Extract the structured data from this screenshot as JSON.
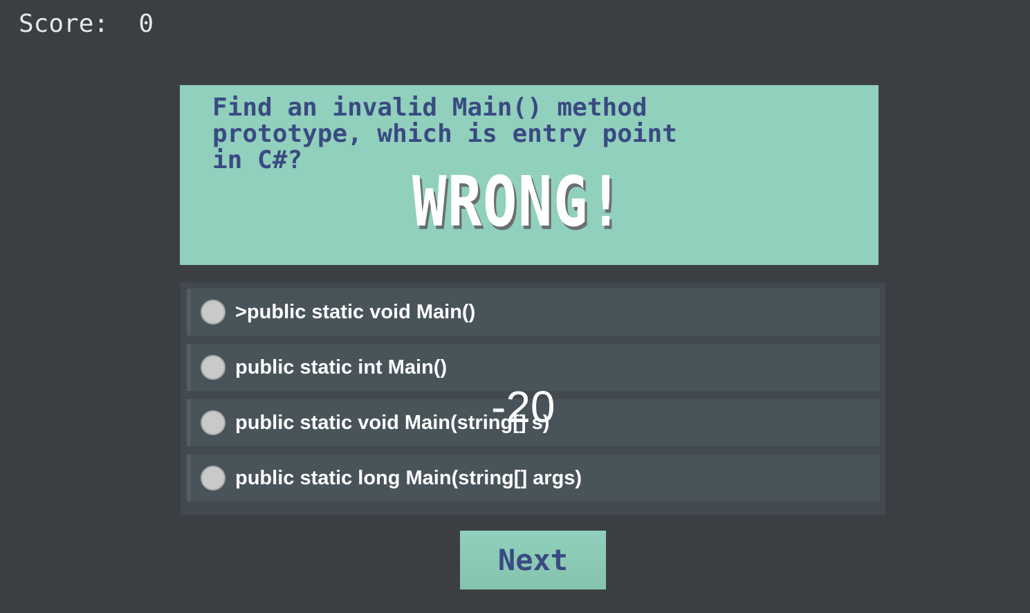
{
  "score": {
    "label": "Score:",
    "value": "0"
  },
  "question": {
    "text": "Find an invalid Main() method prototype, which is entry point in C#?",
    "result": "WRONG!"
  },
  "options": [
    {
      "label": ">public static void Main()"
    },
    {
      "label": "public static int Main()"
    },
    {
      "label": "public static void Main(string[] s)"
    },
    {
      "label": "public static long Main(string[] args)"
    }
  ],
  "penalty": "-20",
  "buttons": {
    "next": "Next"
  },
  "colors": {
    "background": "#3b3f43",
    "accent": "#90d0bc",
    "text_accent": "#3a4a82"
  }
}
